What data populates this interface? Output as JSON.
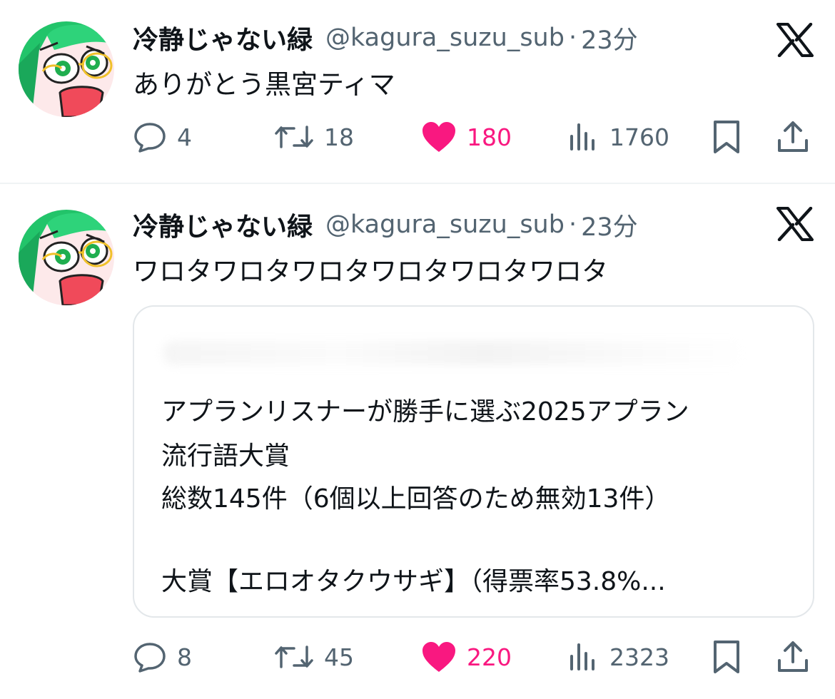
{
  "tweets": [
    {
      "author_name": "冷静じゃない緑",
      "handle": "@kagura_suzu_sub",
      "separator": "·",
      "time": "23分",
      "text": "ありがとう黒宮ティマ",
      "stats": {
        "replies": "4",
        "retweets": "18",
        "likes": "180",
        "views": "1760"
      }
    },
    {
      "author_name": "冷静じゃない緑",
      "handle": "@kagura_suzu_sub",
      "separator": "·",
      "time": "23分",
      "text": "ワロタワロタワロタワロタワロタワロタ",
      "quote": {
        "lines": [
          "アプランリスナーが勝手に選ぶ2025アプラン",
          "流行語大賞",
          "総数145件（6個以上回答のため無効13件）",
          "大賞【エロオタクウサギ】（得票率53.8%..."
        ]
      },
      "stats": {
        "replies": "8",
        "retweets": "45",
        "likes": "220",
        "views": "2323"
      }
    }
  ],
  "colors": {
    "like_pink": "#f91880",
    "muted_gray": "#536471",
    "text": "#0f1419",
    "border": "#e3e7ea",
    "avatar_green": "#22c46a"
  },
  "icons": [
    "reply-icon",
    "retweet-icon",
    "like-icon",
    "views-icon",
    "bookmark-icon",
    "share-icon",
    "x-logo-icon"
  ]
}
